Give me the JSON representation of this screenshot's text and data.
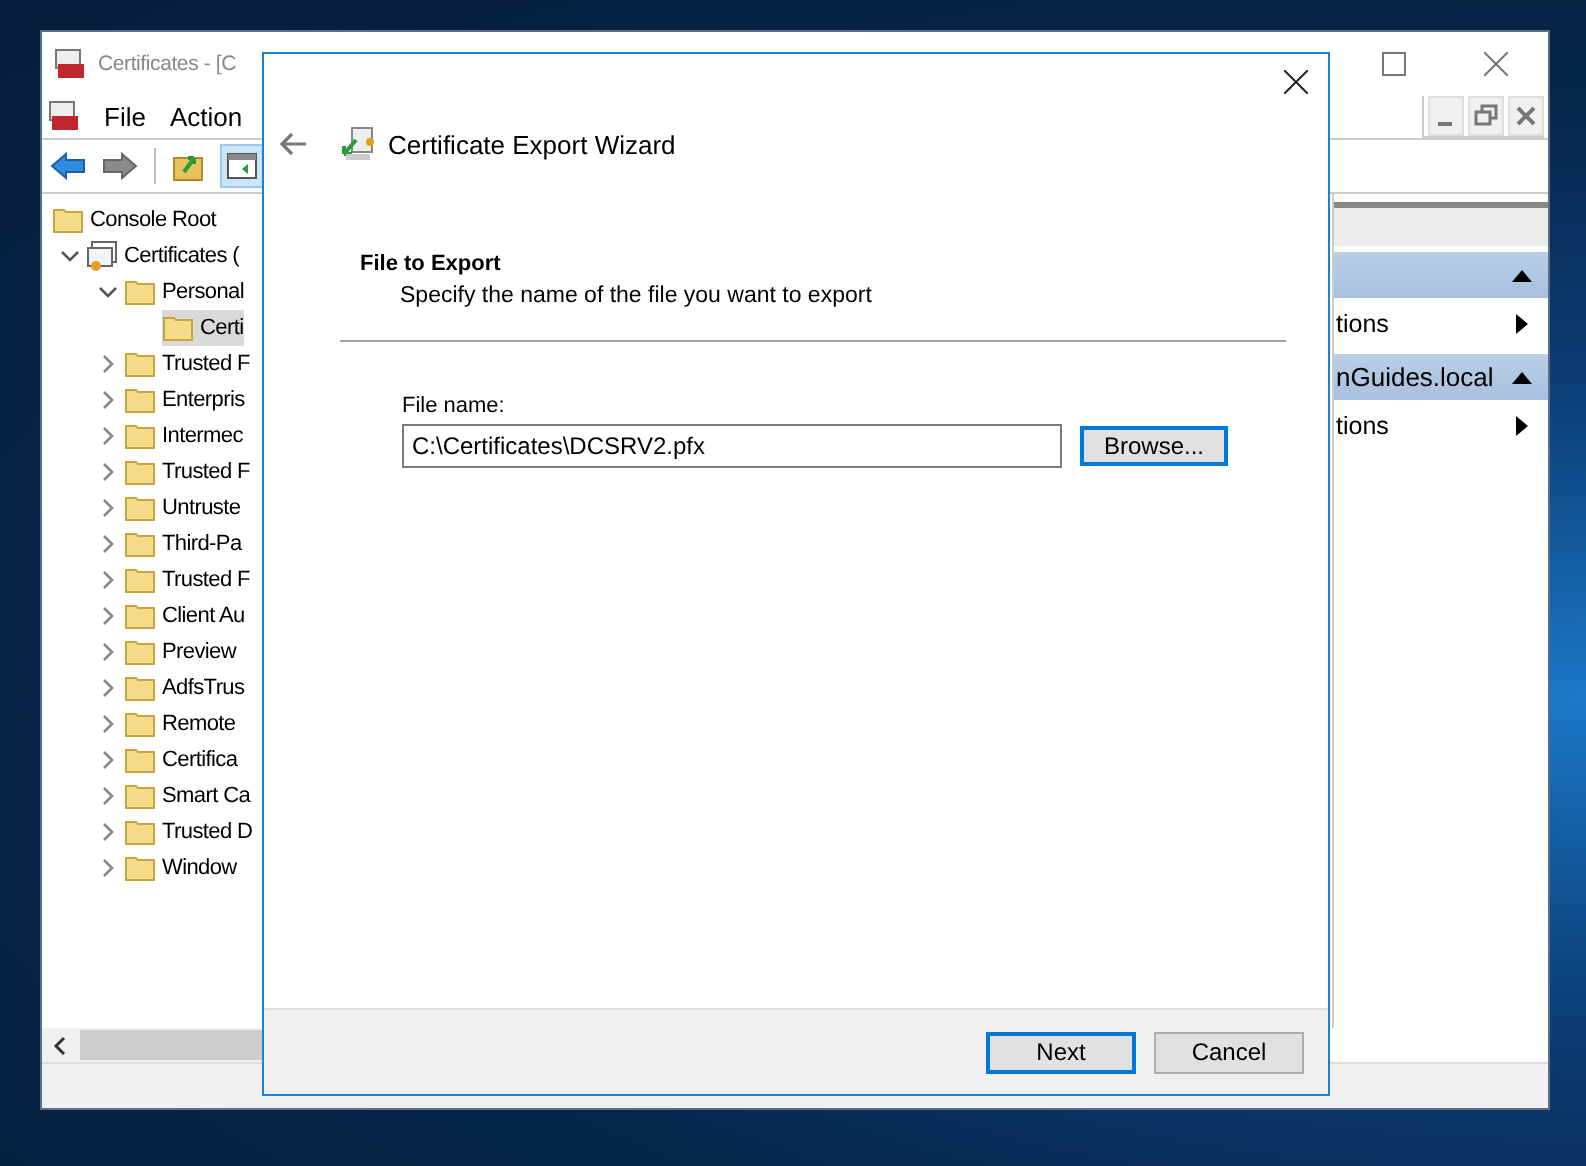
{
  "mmc": {
    "title": "Certificates - [C",
    "menu": [
      "File",
      "Action"
    ],
    "tree": [
      {
        "label": "Console Root",
        "selected": false,
        "children": [
          {
            "label": "Certificates (",
            "expanded": true,
            "selected": false,
            "children": [
              {
                "label": "Personal",
                "expanded": true,
                "selected": false,
                "children": [
                  {
                    "label": "Certi",
                    "selected": true
                  }
                ]
              },
              {
                "label": "Trusted F",
                "expanded": false,
                "selected": false
              },
              {
                "label": "Enterpris",
                "expanded": false,
                "selected": false
              },
              {
                "label": "Intermec",
                "expanded": false,
                "selected": false
              },
              {
                "label": "Trusted F",
                "expanded": false,
                "selected": false
              },
              {
                "label": "Untruste",
                "expanded": false,
                "selected": false
              },
              {
                "label": "Third-Pa",
                "expanded": false,
                "selected": false
              },
              {
                "label": "Trusted F",
                "expanded": false,
                "selected": false
              },
              {
                "label": "Client Au",
                "expanded": false,
                "selected": false
              },
              {
                "label": "Preview",
                "expanded": false,
                "selected": false
              },
              {
                "label": "AdfsTrus",
                "expanded": false,
                "selected": false
              },
              {
                "label": "Remote",
                "expanded": false,
                "selected": false
              },
              {
                "label": "Certifica",
                "expanded": false,
                "selected": false
              },
              {
                "label": "Smart Ca",
                "expanded": false,
                "selected": false
              },
              {
                "label": "Trusted D",
                "expanded": false,
                "selected": false
              },
              {
                "label": "Window",
                "expanded": false,
                "selected": false
              }
            ]
          }
        ]
      }
    ],
    "actions": [
      {
        "kind": "group",
        "expanded": true
      },
      {
        "kind": "item",
        "label": "tions"
      },
      {
        "kind": "group",
        "label": "nGuides.local",
        "expanded": true
      },
      {
        "kind": "item",
        "label": "tions"
      }
    ]
  },
  "dialog": {
    "title": "Certificate Export Wizard",
    "heading": "File to Export",
    "description": "Specify the name of the file you want to export",
    "field": {
      "label": "File name:",
      "value": "C:\\Certificates\\DCSRV2.pfx"
    },
    "browse": {
      "label": "Browse...",
      "focused": true
    },
    "buttons": [
      {
        "label": "Next",
        "focused": true
      },
      {
        "label": "Cancel",
        "focused": false
      }
    ]
  }
}
